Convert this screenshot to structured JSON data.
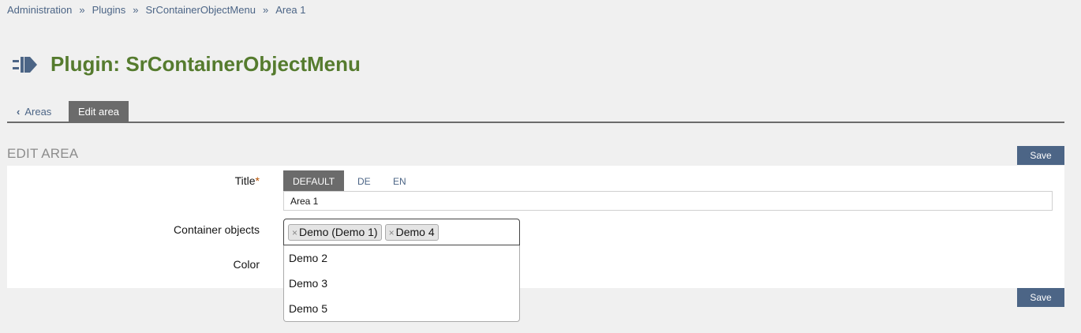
{
  "breadcrumb": {
    "items": [
      "Administration",
      "Plugins",
      "SrContainerObjectMenu",
      "Area 1"
    ],
    "separator": "»"
  },
  "header": {
    "title": "Plugin: SrContainerObjectMenu",
    "icon": "plugin-plug-icon"
  },
  "tabs": {
    "back_label": "Areas",
    "active_label": "Edit area"
  },
  "section": {
    "title": "EDIT AREA",
    "save_label": "Save"
  },
  "form": {
    "title_label": "Title",
    "required_marker": "*",
    "language_tabs": [
      "DEFAULT",
      "DE",
      "EN"
    ],
    "active_language": "DEFAULT",
    "title_value": "Area 1",
    "containers_label": "Container objects",
    "selected_containers": [
      "Demo (Demo 1)",
      "Demo 4"
    ],
    "chip_remove_glyph": "×",
    "dropdown_options": [
      "Demo 2",
      "Demo 3",
      "Demo 5"
    ],
    "color_label": "Color"
  },
  "colors": {
    "accent": "#4c6586",
    "title_green": "#557b2e",
    "tab_active_bg": "#6b6b6b",
    "required": "#b54f00"
  }
}
